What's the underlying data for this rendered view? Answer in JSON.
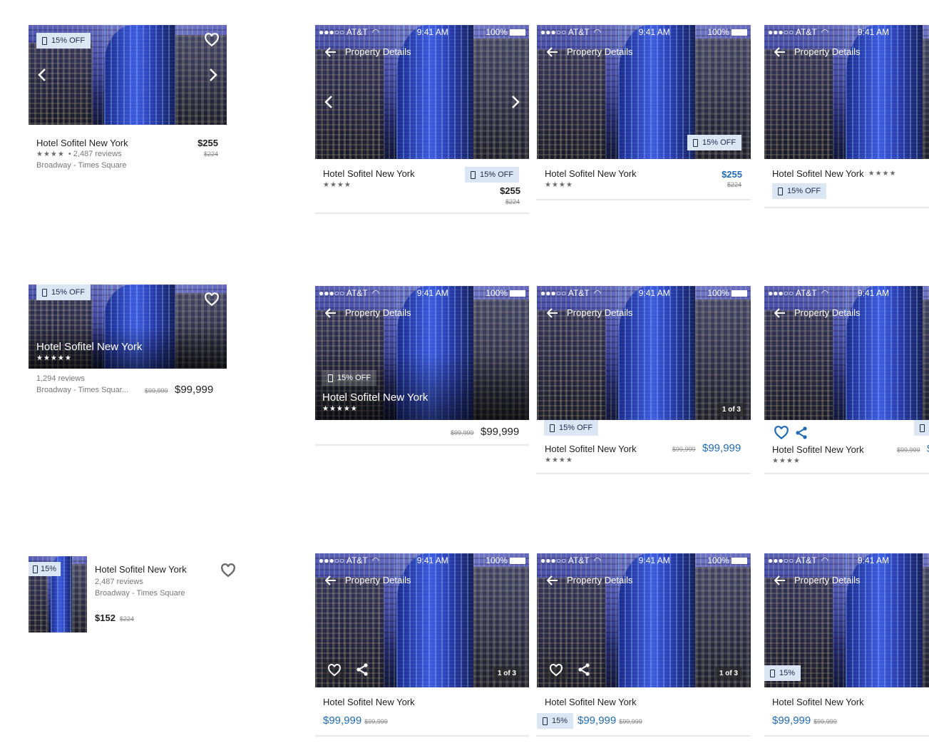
{
  "hotel": {
    "name": "Hotel Sofitel New York",
    "name_truncated": "Hotel Sofitel New York",
    "location": "Broadway - Times Square",
    "location_truncated": "Broadway - Times Squar...",
    "reviews_2487": "• 2,487 reviews",
    "reviews_2487_plain": "2,487 reviews",
    "reviews_1294": "1,294 reviews",
    "stars4": "★★★★",
    "stars5": "★★★★★"
  },
  "badges": {
    "off15": "15% OFF",
    "short15": "15%"
  },
  "prices": {
    "p255": "$255",
    "p224": "$224",
    "p152": "$152",
    "p99999": "$99,999",
    "p99999_old": "$99,999",
    "p9999_clipped": "$",
    "p99999_old_clip": "$99,999"
  },
  "status_bar": {
    "carrier": "●●●○○ AT&T",
    "time": "9:41 AM",
    "battery": "100%"
  },
  "nav": {
    "title": "Property Details"
  },
  "pager": {
    "label": "1 of 3"
  },
  "colors": {
    "accent": "#1f6bb8",
    "badge_bg": "#dbe6f5"
  },
  "icons": [
    "heart-icon",
    "chevron-left-icon",
    "chevron-right-icon",
    "arrow-left-icon",
    "share-icon",
    "phone-icon",
    "wifi-icon",
    "battery-icon"
  ]
}
